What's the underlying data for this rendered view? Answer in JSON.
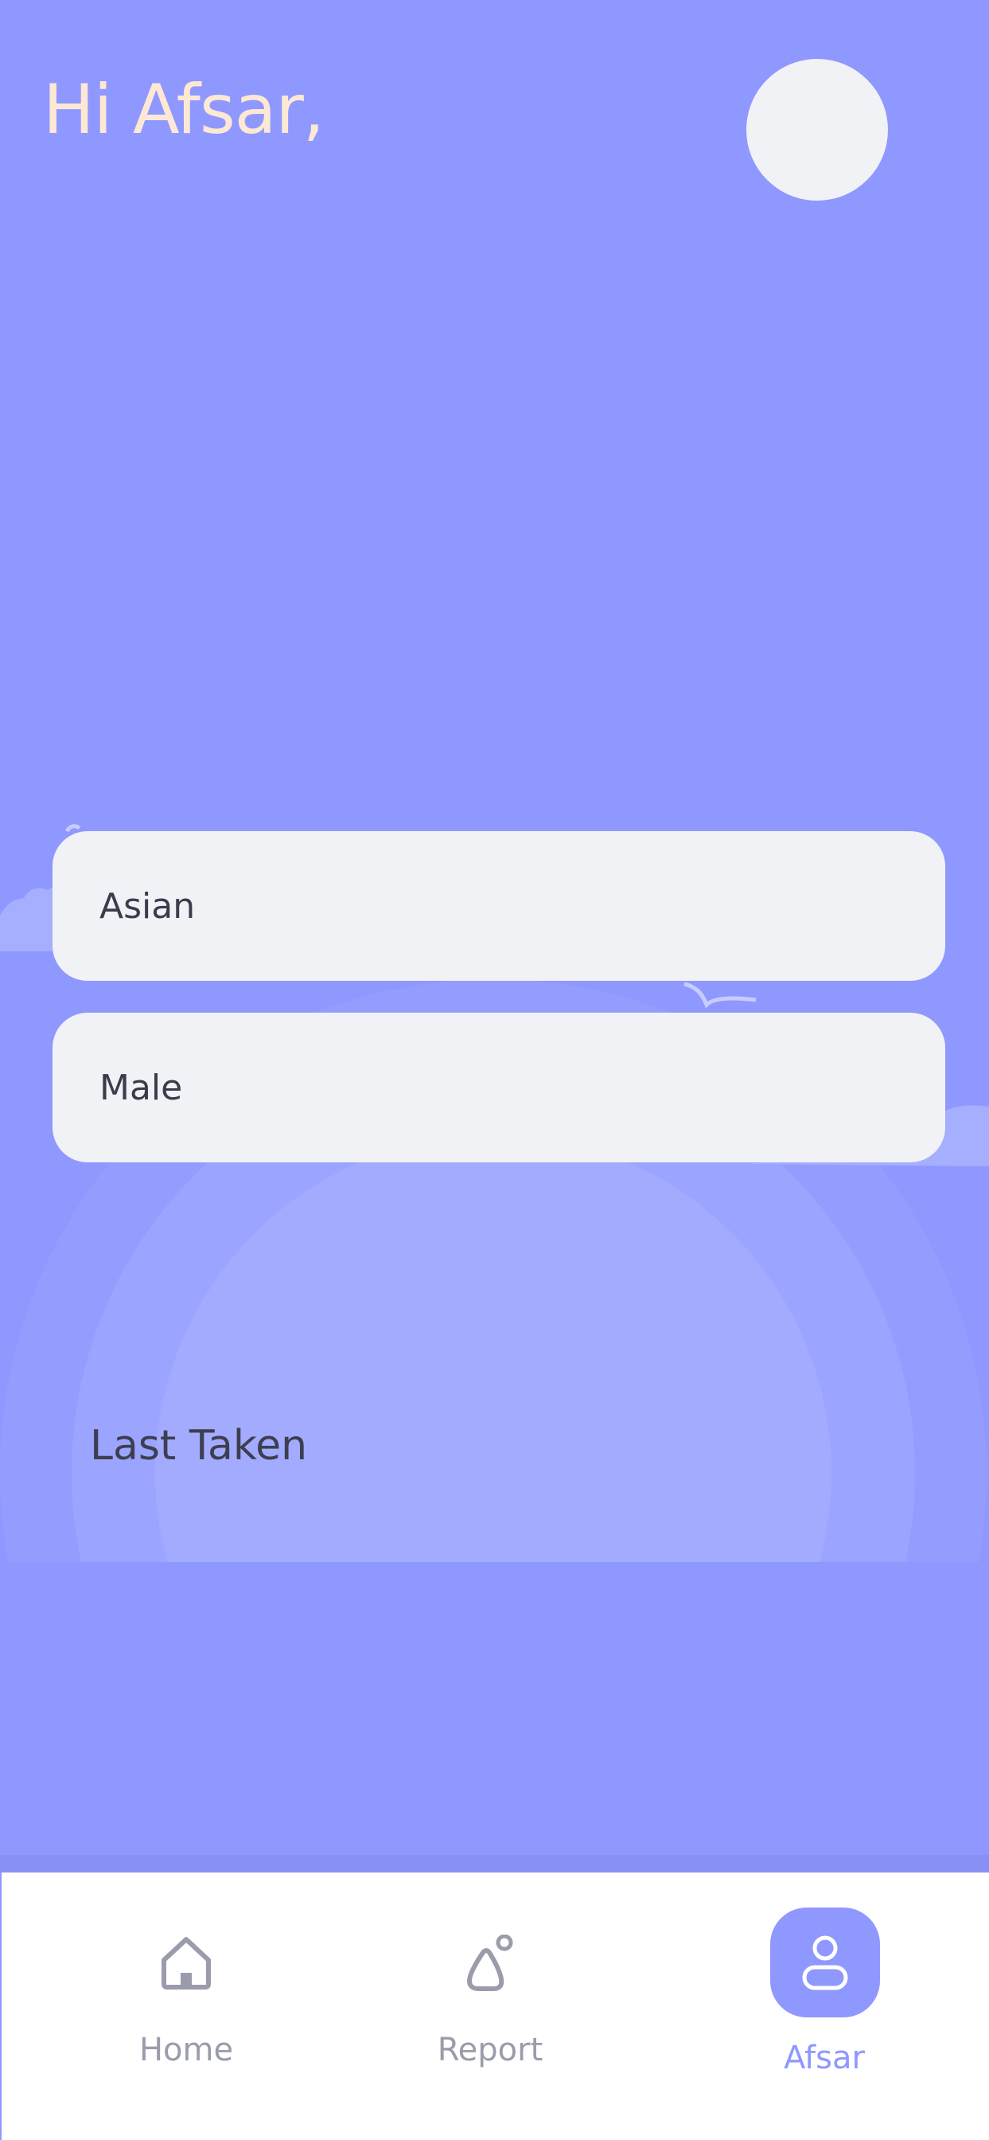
{
  "header": {
    "greeting": "Hi Afsar,"
  },
  "profile": {
    "ethnicity_value": "Asian",
    "gender_value": "Male"
  },
  "section": {
    "last_taken_label": "Last Taken"
  },
  "bottom_nav": {
    "items": [
      {
        "label": "Home",
        "icon": "home-icon",
        "active": false
      },
      {
        "label": "Report",
        "icon": "report-icon",
        "active": false
      },
      {
        "label": "Afsar",
        "icon": "profile-icon",
        "active": true
      }
    ]
  },
  "colors": {
    "background": "#8f98fe",
    "greeting_text": "#fde8d4",
    "card": "#f1f2f6",
    "nav_inactive": "#9a9cab",
    "nav_active": "#8f98fe"
  }
}
